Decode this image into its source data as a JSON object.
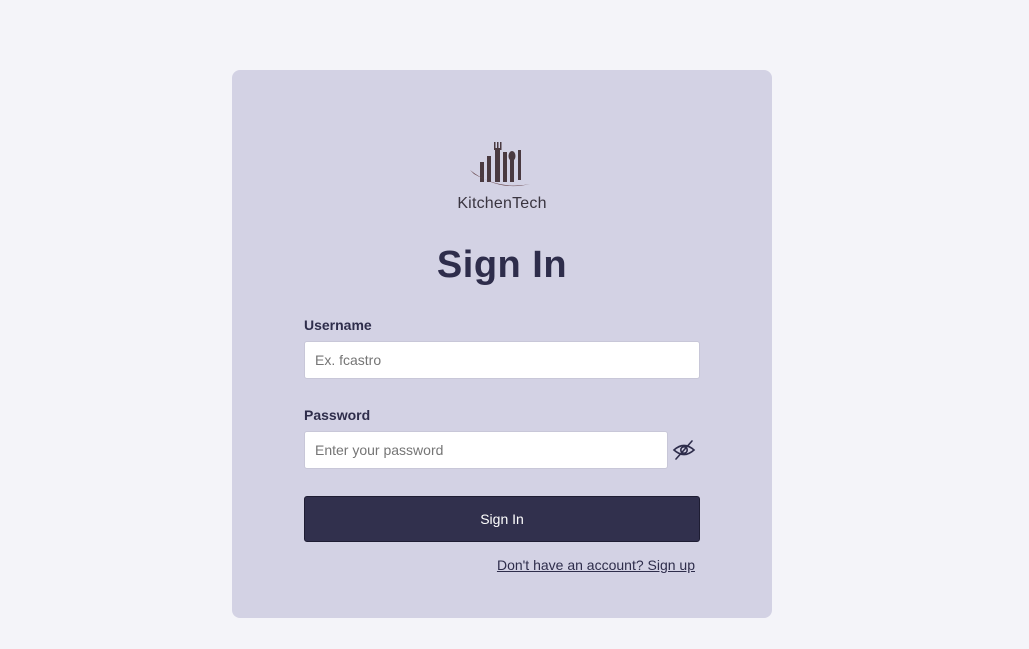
{
  "brand": {
    "name": "KitchenTech",
    "logo_icon": "kitchen-utensils-buildings-logo"
  },
  "form": {
    "title": "Sign In",
    "username": {
      "label": "Username",
      "placeholder": "Ex. fcastro",
      "value": ""
    },
    "password": {
      "label": "Password",
      "placeholder": "Enter your password",
      "value": "",
      "toggle_icon": "eye-off-icon"
    },
    "submit_label": "Sign In",
    "signup_link": "Don't have an account? Sign up"
  },
  "colors": {
    "page_bg": "#f4f4f9",
    "card_bg": "#d3d2e4",
    "primary": "#31304d",
    "text": "#2e2d4b"
  }
}
